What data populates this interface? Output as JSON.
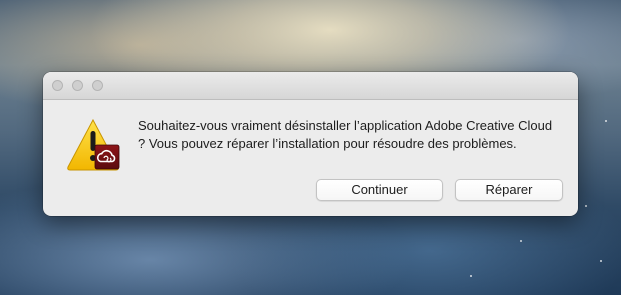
{
  "dialog": {
    "message": "Souhaitez-vous vraiment désinstaller l’application Adobe Creative Cloud ? Vous pouvez réparer l’installation pour résoudre des problèmes.",
    "icon": "warning-triangle-with-adobe-creative-cloud-badge",
    "buttons": {
      "continue_label": "Continuer",
      "repair_label": "Réparer"
    }
  },
  "colors": {
    "warning_yellow": "#f5c400",
    "adobe_red": "#da1f26"
  }
}
